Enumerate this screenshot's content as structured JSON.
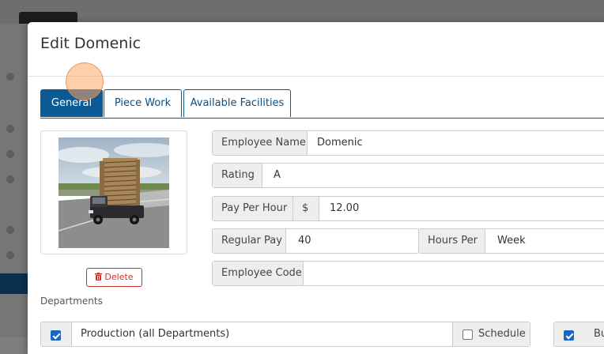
{
  "modal": {
    "title": "Edit Domenic"
  },
  "tabs": [
    {
      "label": "General",
      "active": true
    },
    {
      "label": "Piece Work",
      "active": false
    },
    {
      "label": "Available Facilities",
      "active": false
    }
  ],
  "photo": {
    "delete_label": "Delete"
  },
  "fields": {
    "employee_name": {
      "label": "Employee Name",
      "value": "Domenic"
    },
    "rating": {
      "label": "Rating",
      "value": "A"
    },
    "pay_per_hour": {
      "label": "Pay Per Hour",
      "currency": "$",
      "value": "12.00"
    },
    "regular_pay": {
      "label": "Regular Pay",
      "value": "40"
    },
    "hours_per": {
      "label": "Hours Per",
      "value": "Week"
    },
    "employee_code": {
      "label": "Employee Code",
      "value": ""
    }
  },
  "departments": {
    "label": "Departments",
    "rows": [
      {
        "name": "Production (all Departments)",
        "checked": true,
        "schedule_label": "Schedule",
        "schedule_checked": false
      }
    ],
    "partial_label": "Bu"
  },
  "colors": {
    "primary": "#0b5a96",
    "danger": "#c9302c",
    "checkbox": "#1a66c4"
  }
}
